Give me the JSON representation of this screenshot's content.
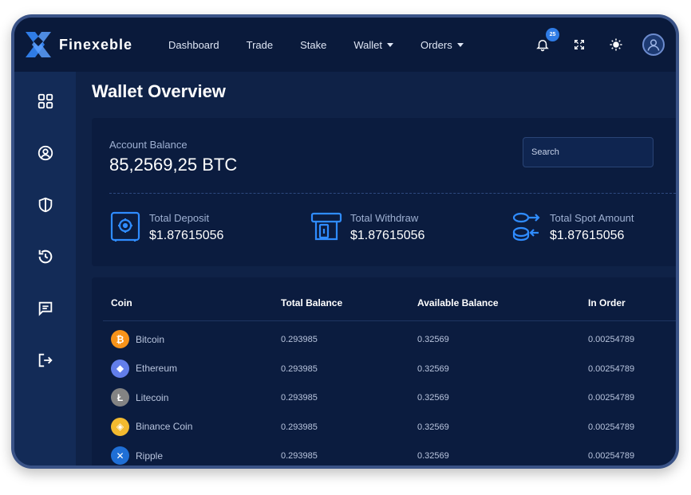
{
  "brand": {
    "name": "Finexeble"
  },
  "nav": [
    {
      "label": "Dashboard",
      "dropdown": false
    },
    {
      "label": "Trade",
      "dropdown": false
    },
    {
      "label": "Stake",
      "dropdown": false
    },
    {
      "label": "Wallet",
      "dropdown": true
    },
    {
      "label": "Orders",
      "dropdown": true
    }
  ],
  "header": {
    "notification_count": "25"
  },
  "sidebar": [
    "dashboard-icon",
    "user-icon",
    "shield-icon",
    "history-icon",
    "chat-icon",
    "logout-icon"
  ],
  "page": {
    "title": "Wallet Overview"
  },
  "account": {
    "label": "Account Balance",
    "value": "85,2569,25 BTC"
  },
  "search": {
    "placeholder": "Search"
  },
  "stats": [
    {
      "label": "Total Deposit",
      "value": "$1.87615056",
      "icon": "vault-icon"
    },
    {
      "label": "Total Withdraw",
      "value": "$1.87615056",
      "icon": "atm-icon"
    },
    {
      "label": "Total Spot Amount",
      "value": "$1.87615056",
      "icon": "coins-exchange-icon"
    }
  ],
  "table": {
    "headers": [
      "Coin",
      "Total Balance",
      "Available Balance",
      "In Order"
    ],
    "rows": [
      {
        "coin": "Bitcoin",
        "total": "0.293985",
        "available": "0.32569",
        "in_order": "0.00254789",
        "color": "#f7931a",
        "glyph": "₿"
      },
      {
        "coin": "Ethereum",
        "total": "0.293985",
        "available": "0.32569",
        "in_order": "0.00254789",
        "color": "#627eea",
        "glyph": "◆"
      },
      {
        "coin": "Litecoin",
        "total": "0.293985",
        "available": "0.32569",
        "in_order": "0.00254789",
        "color": "#838383",
        "glyph": "Ł"
      },
      {
        "coin": "Binance Coin",
        "total": "0.293985",
        "available": "0.32569",
        "in_order": "0.00254789",
        "color": "#f3ba2f",
        "glyph": "◈"
      },
      {
        "coin": "Ripple",
        "total": "0.293985",
        "available": "0.32569",
        "in_order": "0.00254789",
        "color": "#1f6fd6",
        "glyph": "✕"
      }
    ]
  },
  "colors": {
    "accent": "#2f7ce6",
    "background": "#0f2247",
    "card": "#0b1c3f",
    "sidebar": "#132b57"
  }
}
